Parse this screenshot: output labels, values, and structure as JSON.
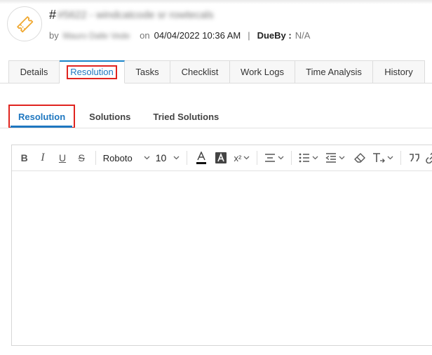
{
  "header": {
    "hash": "#",
    "request_id_and_subject": "#5622 - windcatcode sr rowtecals",
    "by_label": "by",
    "requester": "Mauro Dalle Vede",
    "on_label": "on",
    "created": "04/04/2022 10:36 AM",
    "separator": "|",
    "dueby_label": "DueBy :",
    "dueby_value": "N/A"
  },
  "tabs": [
    {
      "label": "Details"
    },
    {
      "label": "Resolution"
    },
    {
      "label": "Tasks"
    },
    {
      "label": "Checklist"
    },
    {
      "label": "Work Logs"
    },
    {
      "label": "Time Analysis"
    },
    {
      "label": "History"
    }
  ],
  "subtabs": [
    {
      "label": "Resolution"
    },
    {
      "label": "Solutions"
    },
    {
      "label": "Tried Solutions"
    }
  ],
  "toolbar": {
    "bold": "B",
    "italic": "I",
    "underline": "U",
    "strike": "S",
    "font": "Roboto",
    "size": "10",
    "superscript": "x²"
  },
  "colors": {
    "accent": "#1e77c0",
    "highlight_box": "#e0241f",
    "ticket_icon": "#f0a830"
  }
}
